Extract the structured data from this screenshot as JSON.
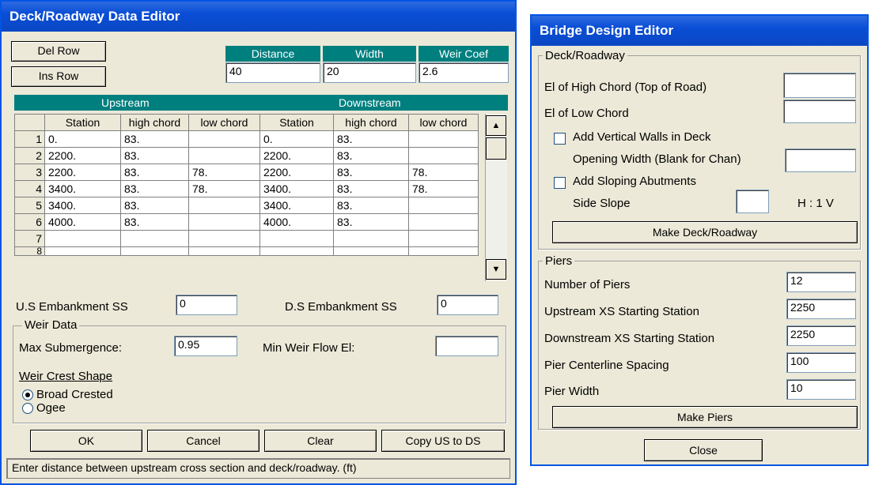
{
  "deck_editor": {
    "title": "Deck/Roadway Data Editor",
    "del_row": "Del Row",
    "ins_row": "Ins Row",
    "headers": {
      "distance": "Distance",
      "width": "Width",
      "weir_coef": "Weir Coef"
    },
    "values": {
      "distance": "40",
      "width": "20",
      "weir_coef": "2.6"
    },
    "upstream_label": "Upstream",
    "downstream_label": "Downstream",
    "columns": [
      "Station",
      "high chord",
      "low chord",
      "Station",
      "high chord",
      "low chord"
    ],
    "rows": [
      {
        "num": "1",
        "cells": [
          "0.",
          "83.",
          "",
          "0.",
          "83.",
          ""
        ]
      },
      {
        "num": "2",
        "cells": [
          "2200.",
          "83.",
          "",
          "2200.",
          "83.",
          ""
        ]
      },
      {
        "num": "3",
        "cells": [
          "2200.",
          "83.",
          "78.",
          "2200.",
          "83.",
          "78."
        ]
      },
      {
        "num": "4",
        "cells": [
          "3400.",
          "83.",
          "78.",
          "3400.",
          "83.",
          "78."
        ]
      },
      {
        "num": "5",
        "cells": [
          "3400.",
          "83.",
          "",
          "3400.",
          "83.",
          ""
        ]
      },
      {
        "num": "6",
        "cells": [
          "4000.",
          "83.",
          "",
          "4000.",
          "83.",
          ""
        ]
      },
      {
        "num": "7",
        "cells": [
          "",
          "",
          "",
          "",
          "",
          ""
        ]
      },
      {
        "num": "8",
        "cells": [
          "",
          "",
          "",
          "",
          "",
          ""
        ]
      }
    ],
    "us_embankment_label": "U.S Embankment SS",
    "us_embankment_value": "0",
    "ds_embankment_label": "D.S Embankment SS",
    "ds_embankment_value": "0",
    "weir_group": "Weir Data",
    "max_sub_label": "Max  Submergence:",
    "max_sub_value": "0.95",
    "min_weir_label": "Min Weir Flow El:",
    "min_weir_value": "",
    "crest_shape_label": "Weir Crest Shape",
    "crest_options": [
      "Broad Crested",
      "Ogee"
    ],
    "crest_selected": "Broad Crested",
    "ok": "OK",
    "cancel": "Cancel",
    "clear": "Clear",
    "copy": "Copy US to DS",
    "status": "Enter distance between upstream cross section and deck/roadway. (ft)"
  },
  "bridge_editor": {
    "title": "Bridge Design Editor",
    "deck_group": "Deck/Roadway",
    "high_chord_label": "El of High Chord (Top of Road)",
    "low_chord_label": "El of Low Chord",
    "vertical_walls_label": "Add Vertical Walls in Deck",
    "opening_width_label": "Opening Width (Blank for Chan)",
    "sloping_label": "Add Sloping Abutments",
    "side_slope_label": "Side Slope",
    "side_slope_unit": "H : 1 V",
    "make_deck": "Make Deck/Roadway",
    "piers_group": "Piers",
    "num_piers_label": "Number of Piers",
    "num_piers_value": "12",
    "us_station_label": "Upstream XS Starting Station",
    "us_station_value": "2250",
    "ds_station_label": "Downstream XS Starting Station",
    "ds_station_value": "2250",
    "spacing_label": "Pier Centerline Spacing",
    "spacing_value": "100",
    "pier_width_label": "Pier Width",
    "pier_width_value": "10",
    "make_piers": "Make Piers",
    "close": "Close"
  }
}
